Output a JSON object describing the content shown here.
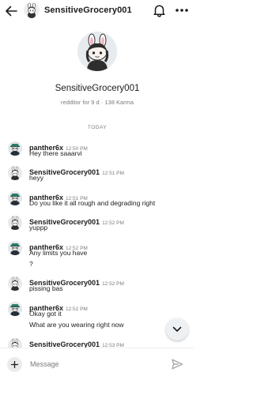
{
  "header": {
    "title": "SensitiveGrocery001"
  },
  "profile": {
    "name": "SensitiveGrocery001",
    "meta": "redditor for 9 d · 138 Karma"
  },
  "day_divider": "TODAY",
  "messages": [
    {
      "author": "panther6x",
      "time": "12:50 PM",
      "lines": [
        "Hey there saaarvi"
      ],
      "avatar": "panther"
    },
    {
      "author": "SensitiveGrocery001",
      "time": "12:51 PM",
      "lines": [
        "heyy"
      ],
      "avatar": "grocery"
    },
    {
      "author": "panther6x",
      "time": "12:51 PM",
      "lines": [
        "Do you like it all rough and degrading right"
      ],
      "avatar": "panther"
    },
    {
      "author": "SensitiveGrocery001",
      "time": "12:52 PM",
      "lines": [
        "yuppp"
      ],
      "avatar": "grocery"
    },
    {
      "author": "panther6x",
      "time": "12:52 PM",
      "lines": [
        "Any limits you have",
        "?"
      ],
      "avatar": "panther"
    },
    {
      "author": "SensitiveGrocery001",
      "time": "12:52 PM",
      "lines": [
        "pissing bas"
      ],
      "avatar": "grocery"
    },
    {
      "author": "panther6x",
      "time": "12:52 PM",
      "lines": [
        "Okay got it",
        "What are you wearing right now"
      ],
      "avatar": "panther"
    },
    {
      "author": "SensitiveGrocery001",
      "time": "12:53 PM",
      "lines": [],
      "avatar": "grocery"
    }
  ],
  "composer": {
    "placeholder": "Message"
  },
  "colors": {
    "text": "#1c1c1c",
    "meta": "#7c7c7c",
    "icon": "#1c1c1c",
    "send_icon": "#a5a8ab"
  },
  "icons": {
    "back": "arrow-left-icon",
    "notifications": "bell-icon",
    "more": "more-horizontal-icon",
    "scroll": "chevron-down-icon",
    "add": "plus-icon",
    "send": "send-icon"
  }
}
